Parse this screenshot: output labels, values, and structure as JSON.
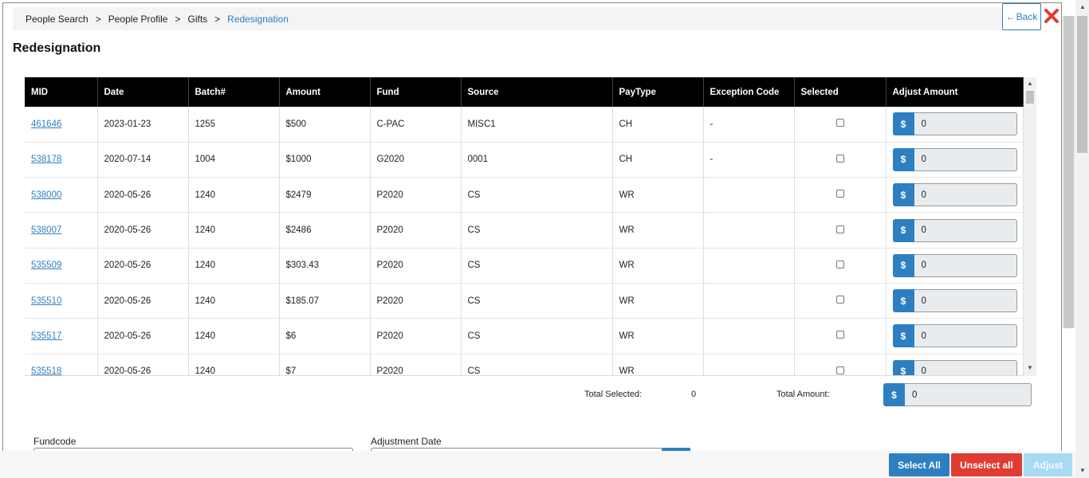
{
  "breadcrumb": {
    "items": [
      "People Search",
      "People Profile",
      "Gifts"
    ],
    "current": "Redesignation",
    "separator": ">"
  },
  "back_label": "Back",
  "page_title": "Redesignation",
  "table": {
    "columns": [
      "MID",
      "Date",
      "Batch#",
      "Amount",
      "Fund",
      "Source",
      "PayType",
      "Exception Code",
      "Selected",
      "Adjust Amount"
    ],
    "rows": [
      {
        "mid": "461646",
        "date": "2023-01-23",
        "batch": "1255",
        "amount": "$500",
        "fund": "C-PAC",
        "source": "MISC1",
        "paytype": "CH",
        "exception": "-",
        "adjust": "0"
      },
      {
        "mid": "538178",
        "date": "2020-07-14",
        "batch": "1004",
        "amount": "$1000",
        "fund": "G2020",
        "source": "0001",
        "paytype": "CH",
        "exception": "-",
        "adjust": "0"
      },
      {
        "mid": "538000",
        "date": "2020-05-26",
        "batch": "1240",
        "amount": "$2479",
        "fund": "P2020",
        "source": "CS",
        "paytype": "WR",
        "exception": "",
        "adjust": "0"
      },
      {
        "mid": "538007",
        "date": "2020-05-26",
        "batch": "1240",
        "amount": "$2486",
        "fund": "P2020",
        "source": "CS",
        "paytype": "WR",
        "exception": "",
        "adjust": "0"
      },
      {
        "mid": "535509",
        "date": "2020-05-26",
        "batch": "1240",
        "amount": "$303.43",
        "fund": "P2020",
        "source": "CS",
        "paytype": "WR",
        "exception": "",
        "adjust": "0"
      },
      {
        "mid": "535510",
        "date": "2020-05-26",
        "batch": "1240",
        "amount": "$185.07",
        "fund": "P2020",
        "source": "CS",
        "paytype": "WR",
        "exception": "",
        "adjust": "0"
      },
      {
        "mid": "535517",
        "date": "2020-05-26",
        "batch": "1240",
        "amount": "$6",
        "fund": "P2020",
        "source": "CS",
        "paytype": "WR",
        "exception": "",
        "adjust": "0"
      },
      {
        "mid": "535518",
        "date": "2020-05-26",
        "batch": "1240",
        "amount": "$7",
        "fund": "P2020",
        "source": "CS",
        "paytype": "WR",
        "exception": "",
        "adjust": "0"
      }
    ],
    "currency_symbol": "$"
  },
  "totals": {
    "selected_label": "Total Selected:",
    "selected_value": "0",
    "amount_label": "Total Amount:",
    "amount_value": "0",
    "currency_symbol": "$"
  },
  "form": {
    "fundcode_label": "Fundcode",
    "adjustment_date_label": "Adjustment Date"
  },
  "actions": {
    "select_all": "Select All",
    "unselect_all": "Unselect all",
    "adjust": "Adjust"
  },
  "colors": {
    "primary": "#2e7fc1",
    "danger": "#e03c31",
    "disabled": "#a7dbf1",
    "header_bg": "#000000"
  }
}
